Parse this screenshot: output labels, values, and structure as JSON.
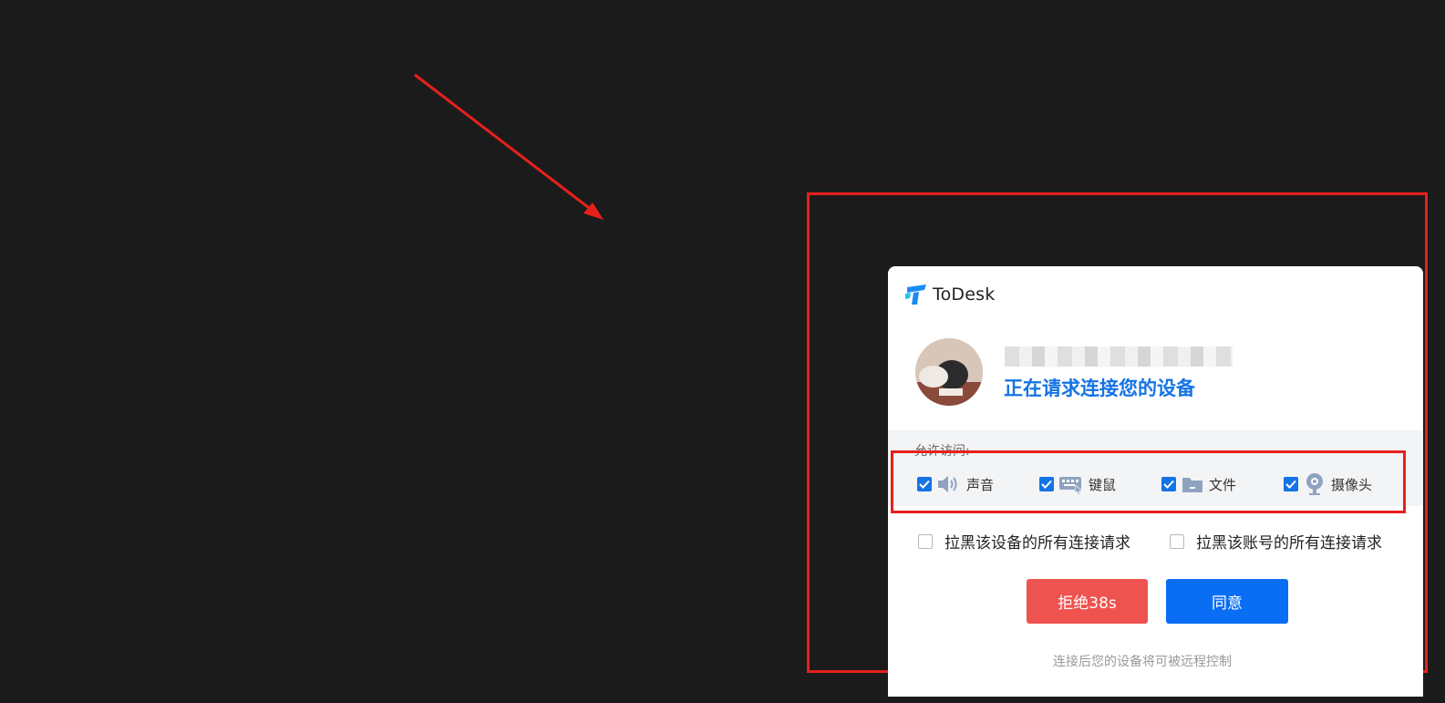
{
  "dialog": {
    "app_name": "ToDesk",
    "requester_name": "████████",
    "request_message": "正在请求连接您的设备",
    "permissions_title": "允许访问:",
    "permissions": [
      {
        "label": "声音",
        "icon": "speaker-icon",
        "checked": true
      },
      {
        "label": "键鼠",
        "icon": "keyboard-mouse-icon",
        "checked": true
      },
      {
        "label": "文件",
        "icon": "folder-icon",
        "checked": true
      },
      {
        "label": "摄像头",
        "icon": "camera-icon",
        "checked": true
      }
    ],
    "block_options": [
      {
        "label": "拉黑该设备的所有连接请求",
        "checked": false
      },
      {
        "label": "拉黑该账号的所有连接请求",
        "checked": false
      }
    ],
    "reject_label": "拒绝38s",
    "accept_label": "同意",
    "footer_note": "连接后您的设备将可被远程控制"
  },
  "colors": {
    "background": "#1b1b1b",
    "annotation_red": "#e8201d",
    "accent_blue": "#1473e6",
    "reject_red": "#ef5350",
    "accept_blue": "#0a6ef5"
  }
}
